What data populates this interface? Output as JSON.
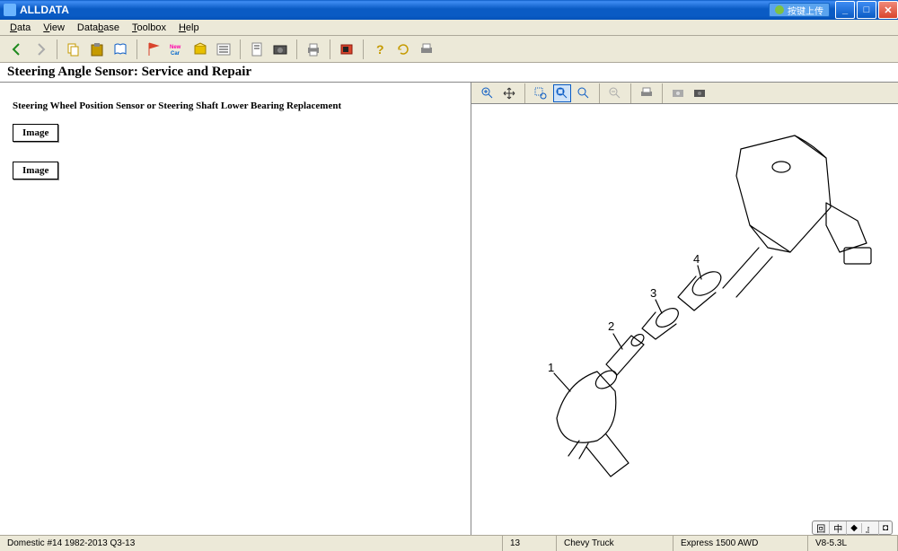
{
  "window": {
    "title": "ALLDATA",
    "upload_btn": "按键上传"
  },
  "menu": {
    "data": "Data",
    "view": "View",
    "database": "Database",
    "toolbox": "Toolbox",
    "help": "Help"
  },
  "page_title": "Steering Angle Sensor:  Service and Repair",
  "content": {
    "heading": "Steering Wheel Position Sensor or Steering Shaft Lower Bearing Replacement",
    "image_btn_1": "Image",
    "image_btn_2": "Image"
  },
  "diagram": {
    "labels": {
      "p1": "1",
      "p2": "2",
      "p3": "3",
      "p4": "4"
    }
  },
  "statusbar": {
    "dataset": "Domestic #14 1982-2013 Q3-13",
    "sequence": "13",
    "make": "Chevy Truck",
    "model": "Express 1500 AWD",
    "engine": "V8-5.3L"
  },
  "ime": {
    "a": "回",
    "b": "中",
    "c": "◆",
    "d": "』",
    "e": "◘"
  }
}
